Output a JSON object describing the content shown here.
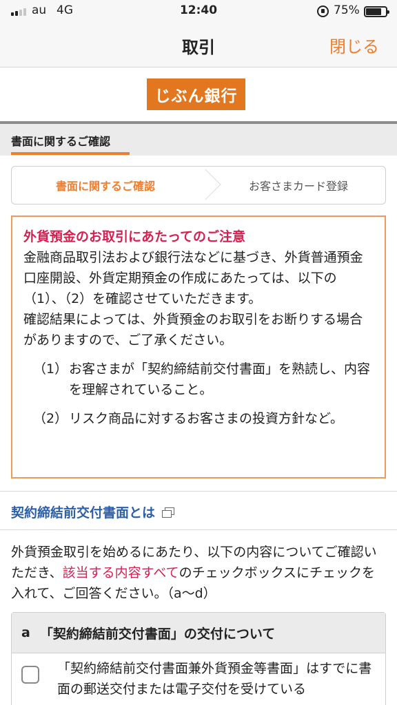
{
  "status_bar": {
    "carrier": "au",
    "network": "4G",
    "time": "12:40",
    "battery": "75%"
  },
  "nav": {
    "title": "取引",
    "close_label": "閉じる"
  },
  "logo": {
    "text": "じぶん銀行",
    "color": "#e3771f"
  },
  "section": {
    "title": "書面に関するご確認"
  },
  "steps": {
    "active": "書面に関するご確認",
    "next": "お客さまカード登録"
  },
  "notice": {
    "title": "外貨預金のお取引にあたってのご注意",
    "paragraph1": "金融商品取引法および銀行法などに基づき、外貨普通預金口座開設、外貨定期預金の作成にあたっては、以下の（1）、（2）を確認させていただきます。",
    "paragraph2": "確認結果によっては、外貨預金のお取引をお断りする場合がありますので、ご了承ください。",
    "items": [
      {
        "num": "（1）",
        "text": "お客さまが「契約締結前交付書面」を熟読し、内容を理解されていること。"
      },
      {
        "num": "（2）",
        "text": "リスク商品に対するお客さまの投資方針など。"
      }
    ]
  },
  "doc_link": {
    "label": "契約締結前交付書面とは"
  },
  "intro": {
    "part1": "外貨預金取引を始めるにあたり、以下の内容についてご確認いただき、",
    "highlight": "該当する内容すべて",
    "part2": "のチェックボックスにチェックを入れて、ご回答ください。（a〜d）"
  },
  "question": {
    "letter": "a",
    "title": "「契約締結前交付書面」の交付について",
    "option_text": "「契約締結前交付書面兼外貨預金等書面」はすでに書面の郵送交付または電子交付を受けている"
  },
  "colors": {
    "accent": "#ee7d2d",
    "alert": "#d6204f",
    "link": "#2b5fa8"
  }
}
